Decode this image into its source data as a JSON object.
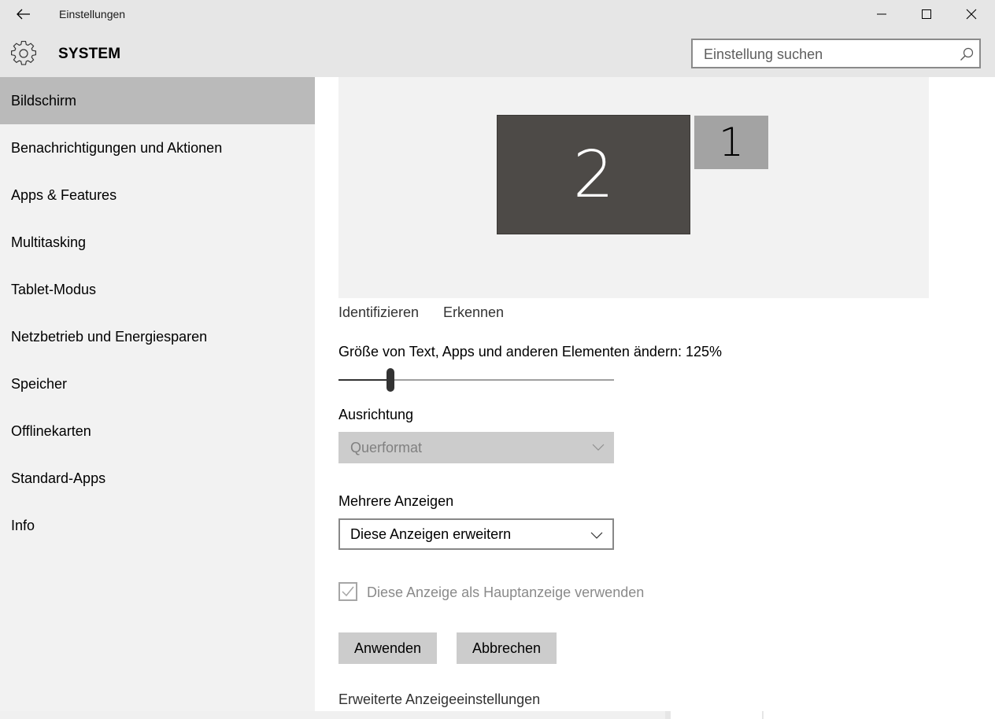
{
  "window": {
    "title": "Einstellungen",
    "minimize_icon": "minimize-icon",
    "maximize_icon": "maximize-icon",
    "close_icon": "close-icon"
  },
  "header": {
    "section_title": "SYSTEM",
    "section_icon": "gear-icon",
    "search_placeholder": "Einstellung suchen",
    "search_icon": "search-icon"
  },
  "sidebar": {
    "items": [
      {
        "label": "Bildschirm",
        "active": true
      },
      {
        "label": "Benachrichtigungen und Aktionen",
        "active": false
      },
      {
        "label": "Apps & Features",
        "active": false
      },
      {
        "label": "Multitasking",
        "active": false
      },
      {
        "label": "Tablet-Modus",
        "active": false
      },
      {
        "label": "Netzbetrieb und Energiesparen",
        "active": false
      },
      {
        "label": "Speicher",
        "active": false
      },
      {
        "label": "Offlinekarten",
        "active": false
      },
      {
        "label": "Standard-Apps",
        "active": false
      },
      {
        "label": "Info",
        "active": false
      }
    ]
  },
  "display": {
    "monitors": [
      {
        "number": "2",
        "selected": true
      },
      {
        "number": "1",
        "selected": false
      }
    ],
    "identify_link": "Identifizieren",
    "detect_link": "Erkennen",
    "scale_label": "Größe von Text, Apps und anderen Elementen ändern: 125%",
    "scale_slider_fraction": 0.18,
    "orientation_label": "Ausrichtung",
    "orientation_value": "Querformat",
    "orientation_disabled": true,
    "multi_display_label": "Mehrere Anzeigen",
    "multi_display_value": "Diese Anzeigen erweitern",
    "main_display_checkbox_label": "Diese Anzeige als Hauptanzeige verwenden",
    "main_display_checked": true,
    "main_display_disabled": true,
    "apply_button": "Anwenden",
    "cancel_button": "Abbrechen",
    "advanced_link": "Erweiterte Anzeigeeinstellungen"
  },
  "colors": {
    "titlebar_bg": "#e6e6e6",
    "sidebar_bg": "#f2f2f2",
    "sidebar_active_bg": "#bababa",
    "selected_monitor_bg": "#4d4a47",
    "other_monitor_bg": "#a3a3a3",
    "button_bg": "#cccccc"
  }
}
